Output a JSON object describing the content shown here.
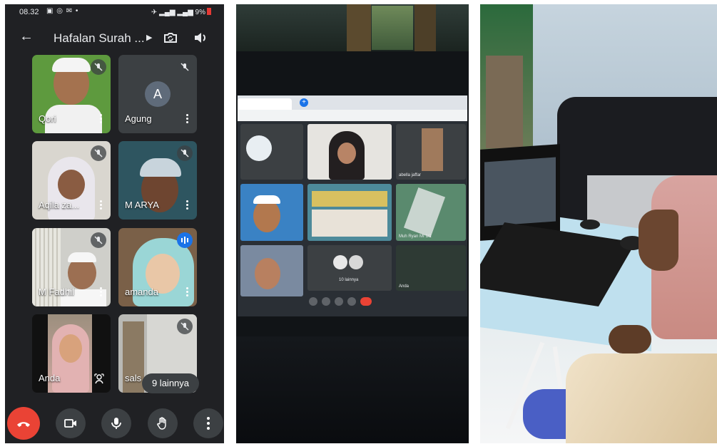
{
  "phone": {
    "status": {
      "time": "08.32",
      "battery": "9%"
    },
    "header": {
      "title": "Hafalan Surah ..."
    },
    "participants": [
      {
        "name": "Qori",
        "muted": true,
        "bg": "#5e9a3e"
      },
      {
        "name": "Agung",
        "muted": true,
        "initial": "A",
        "bg": "#3c4043"
      },
      {
        "name": "Aqila za...",
        "muted": true,
        "bg": "#d9d6cf"
      },
      {
        "name": "M ARYA",
        "muted": true,
        "bg": "#2e5560"
      },
      {
        "name": "M Fadhil",
        "muted": true,
        "bg": "#cfcfca"
      },
      {
        "name": "amanda",
        "muted": false,
        "bg": "#7a6048"
      },
      {
        "name": "Anda",
        "muted": false,
        "bg": "#111"
      },
      {
        "name": "sals",
        "muted": true,
        "bg": "#b9b9b5"
      }
    ],
    "more_label": "9 lainnya",
    "colors": {
      "end_call": "#ea4335",
      "speaking": "#1a73e8"
    }
  },
  "laptop_meeting": {
    "tiles": [
      {
        "label": ""
      },
      {
        "label": ""
      },
      {
        "label": "abella jaffar"
      },
      {
        "label": ""
      },
      {
        "label": ""
      },
      {
        "label": "Muh Ryan MI 1/1"
      },
      {
        "label": ""
      },
      {
        "label": "10 lainnya"
      },
      {
        "label": "Anda"
      }
    ]
  }
}
